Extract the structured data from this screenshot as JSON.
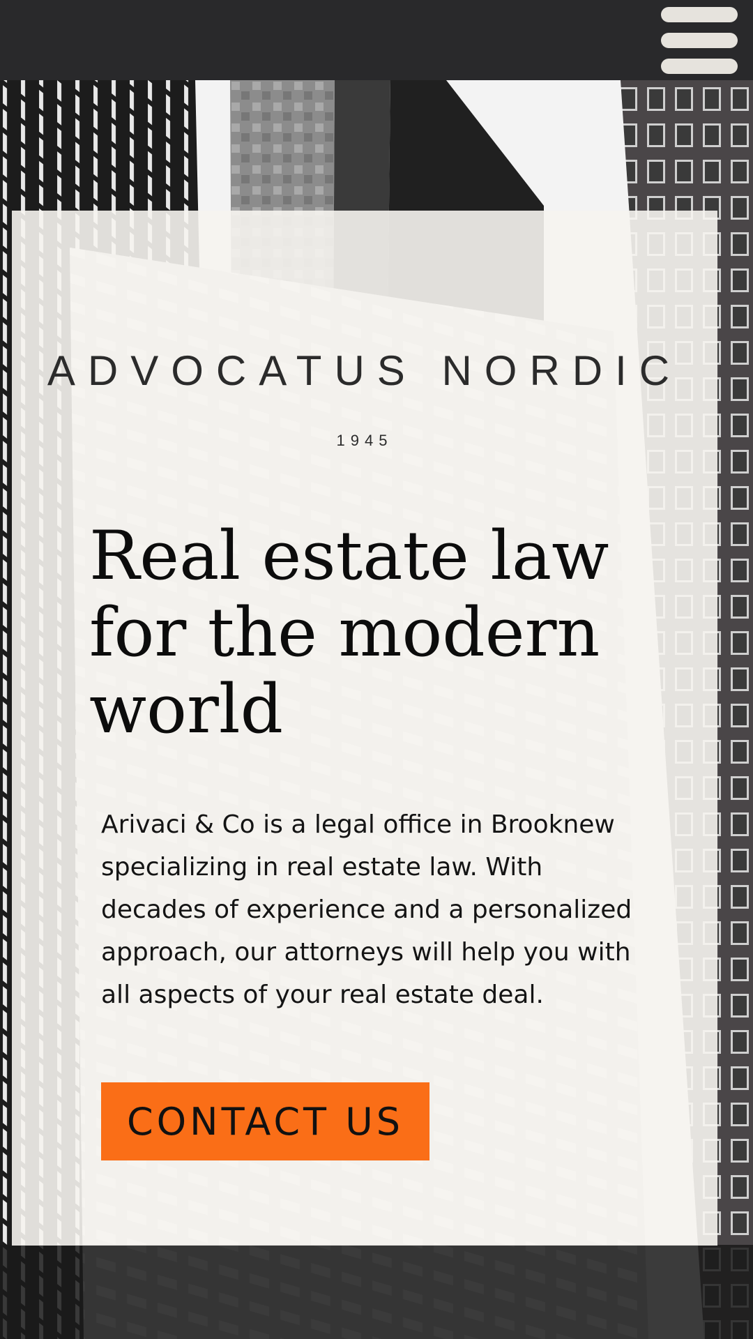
{
  "header": {
    "menu_icon": "hamburger-menu-icon",
    "background_color": "#29292b"
  },
  "hero": {
    "background_image": "black-and-white-skyscrapers-photo",
    "brand_name": "ADVOCATUS NORDIC",
    "brand_year": "1945",
    "headline": "Real estate law for the modern world",
    "description": "Arivaci & Co is a legal office in Brooknew specializing in real estate law. With decades of experience and a personalized approach, our attorneys will help you with all aspects of your real estate deal.",
    "cta_label": "CONTACT US"
  },
  "colors": {
    "accent": "#fa6e17",
    "card_background": "#f6f4f0",
    "text": "#111111"
  }
}
